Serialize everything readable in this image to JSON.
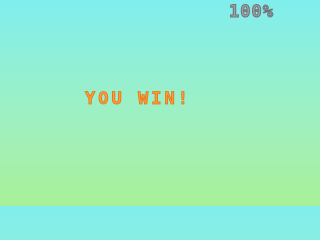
{
  "hud": {
    "progress": "100%"
  },
  "message": {
    "text": "YOU WIN!"
  },
  "colors": {
    "background_top": "#80eeee",
    "background_bottom": "#a8f098",
    "message": "#ff9a3c",
    "progress": "#9fa3a8"
  }
}
